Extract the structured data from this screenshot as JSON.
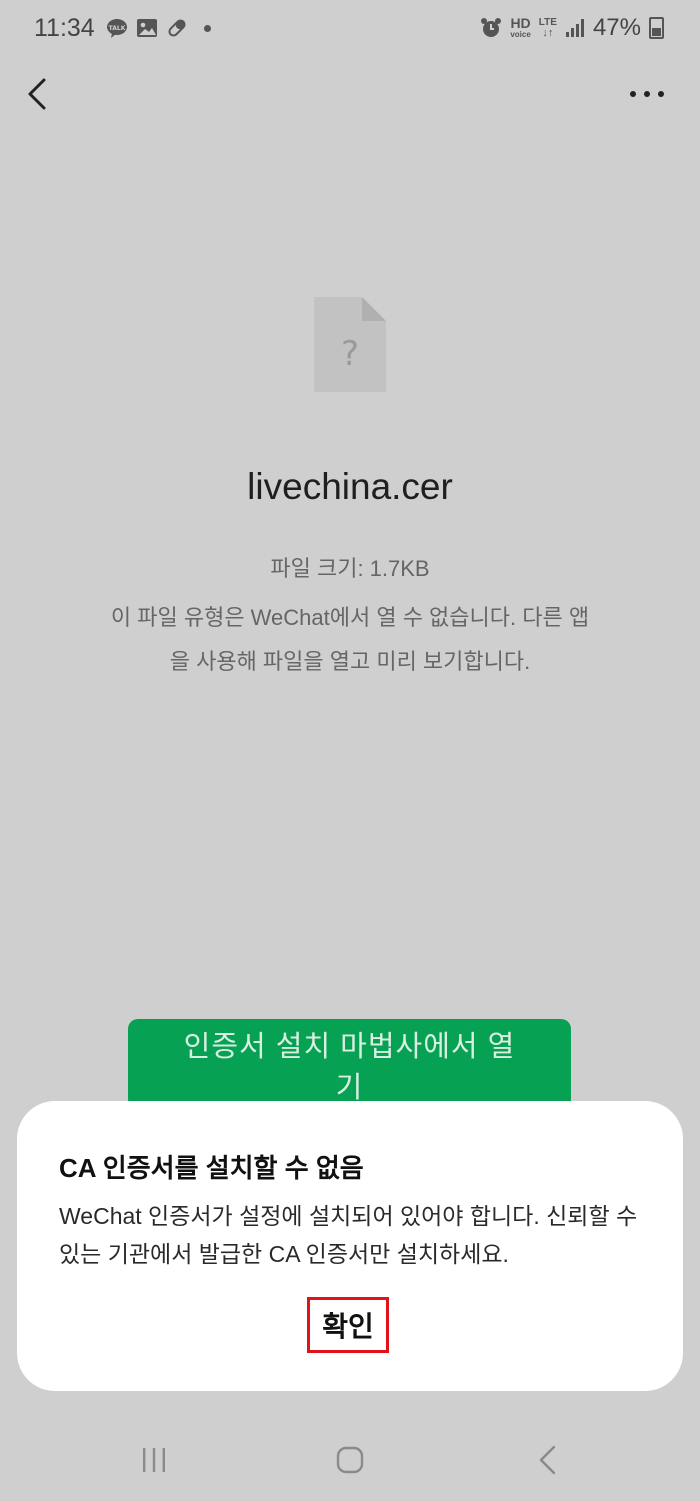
{
  "status_bar": {
    "time": "11:34",
    "left_icons": [
      "talk-icon",
      "gallery-icon",
      "pill-icon"
    ],
    "network_top": "HD",
    "network_bottom": "voice",
    "lte_label": "LTE",
    "battery": "47%"
  },
  "header": {
    "back_icon": "chevron-left-icon",
    "more_icon": "more-horizontal-icon"
  },
  "file": {
    "icon": "unknown-file-icon",
    "icon_glyph": "?",
    "name": "livechina.cer",
    "size_text": "파일 크기: 1.7KB",
    "message": "이 파일 유형은 WeChat에서 열 수 없습니다. 다른 앱을 사용해 파일을 열고 미리 보기합니다."
  },
  "open_wizard_button": {
    "label": "인증서 설치 마법사에서 열기"
  },
  "dialog": {
    "title": "CA 인증서를 설치할 수 없음",
    "body": "WeChat 인증서가 설정에 설치되어 있어야 합니다. 신뢰할 수 있는 기관에서 발급한 CA 인증서만 설치하세요.",
    "confirm_label": "확인",
    "highlight_color": "#e0131a"
  },
  "nav_bar": {
    "recent_icon": "recent-apps-icon",
    "home_icon": "home-icon",
    "back_icon": "nav-back-icon"
  }
}
